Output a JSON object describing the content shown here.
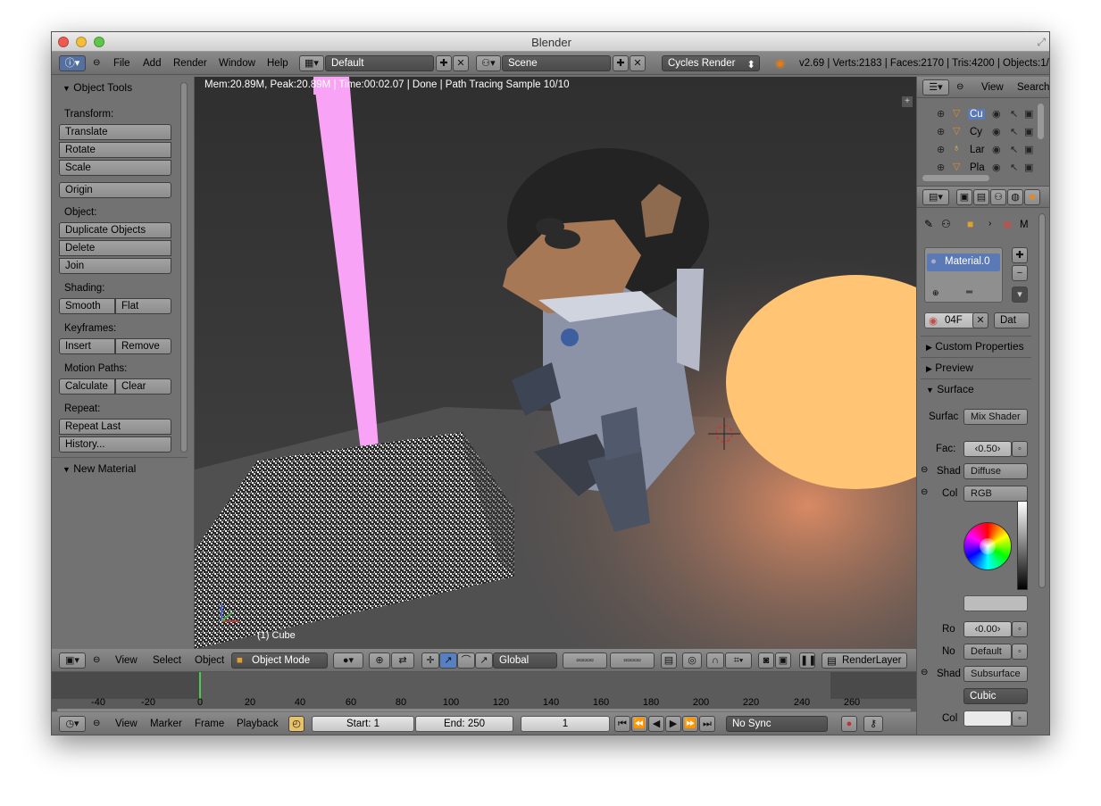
{
  "window": {
    "title": "Blender"
  },
  "info_header": {
    "menus": [
      "File",
      "Add",
      "Render",
      "Window",
      "Help"
    ],
    "screen_layout": "Default",
    "scene": "Scene",
    "render_engine": "Cycles Render",
    "stats": "v2.69 | Verts:2183 | Faces:2170 | Tris:4200 | Objects:1/"
  },
  "viewport": {
    "status": "Mem:20.89M, Peak:20.89M | Time:00:02.07 | Done | Path Tracing Sample 10/10",
    "object_label": "(1) Cube"
  },
  "tool_shelf": {
    "title": "Object Tools",
    "transform_label": "Transform:",
    "translate": "Translate",
    "rotate": "Rotate",
    "scale": "Scale",
    "origin": "Origin",
    "object_label": "Object:",
    "duplicate": "Duplicate Objects",
    "delete": "Delete",
    "join": "Join",
    "shading_label": "Shading:",
    "smooth": "Smooth",
    "flat": "Flat",
    "keyframes_label": "Keyframes:",
    "insert": "Insert",
    "remove": "Remove",
    "motion_label": "Motion Paths:",
    "calculate": "Calculate",
    "clear": "Clear",
    "repeat_label": "Repeat:",
    "repeat_last": "Repeat Last",
    "history": "History...",
    "new_material": "New Material"
  },
  "view3d_header": {
    "menus": [
      "View",
      "Select",
      "Object"
    ],
    "mode": "Object Mode",
    "orientation": "Global",
    "render_layer": "RenderLayer"
  },
  "timeline": {
    "ticks": [
      "-40",
      "-20",
      "0",
      "20",
      "40",
      "60",
      "80",
      "100",
      "120",
      "140",
      "160",
      "180",
      "200",
      "220",
      "240",
      "260"
    ],
    "menus": [
      "View",
      "Marker",
      "Frame",
      "Playback"
    ],
    "start": "Start: 1",
    "end": "End: 250",
    "current": "1",
    "sync": "No Sync"
  },
  "outliner": {
    "view": "View",
    "search": "Search",
    "rows": [
      {
        "name": "Cu",
        "icon_color": "#e08a2a"
      },
      {
        "name": "Cy",
        "icon_color": "#e08a2a"
      },
      {
        "name": "Lar",
        "icon_color": "#f0c040"
      },
      {
        "name": "Pla",
        "icon_color": "#e08a2a"
      }
    ]
  },
  "properties": {
    "breadcrumb_tail": "M",
    "material_slot": "Material.0",
    "material_field": "04F",
    "data_toggle": "Dat",
    "custom_props": "Custom Properties",
    "preview": "Preview",
    "surface": "Surface",
    "surface_label": "Surfac",
    "surface_value": "Mix Shader",
    "fac_label": "Fac:",
    "fac_value": "0.50",
    "shad1_label": "Shad",
    "shad1_value": "Diffuse BSDF",
    "col_label": "Col",
    "col_value": "RGB",
    "ro_label": "Ro",
    "ro_value": "0.00",
    "no_label": "No",
    "no_value": "Default",
    "shad2_label": "Shad",
    "shad2_value": "Subsurface S",
    "cubic": "Cubic",
    "col2_label": "Col"
  }
}
